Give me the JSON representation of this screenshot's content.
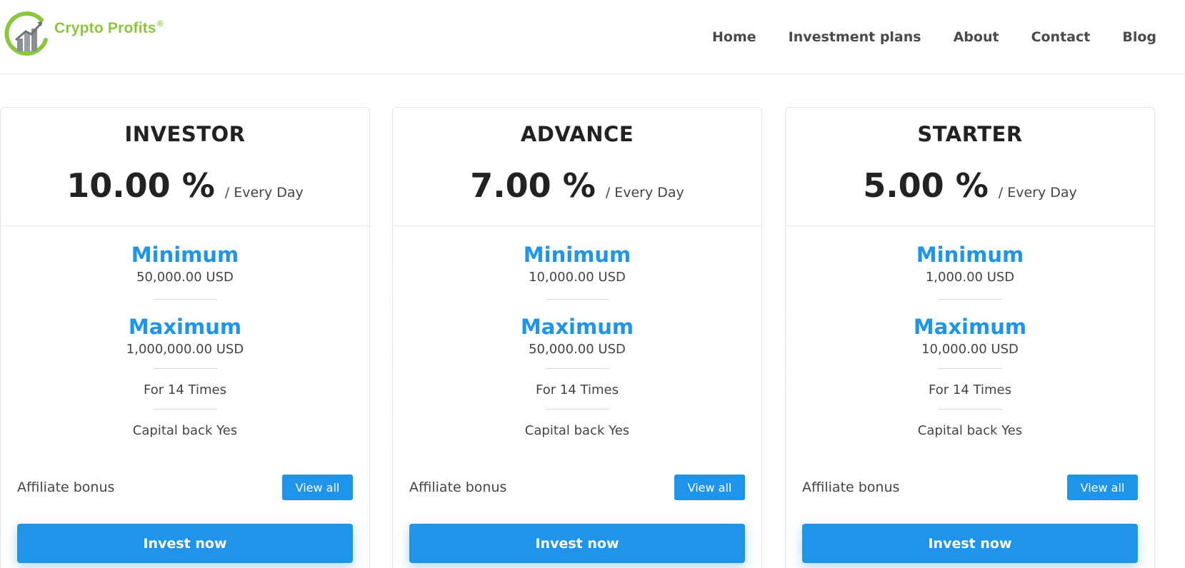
{
  "brand": {
    "name": "Crypto Profits",
    "registered_mark": "®",
    "icon": "bar-chart-circle-logo",
    "color_green": "#8cc63f",
    "color_gray": "#8a8d91"
  },
  "nav": {
    "items": [
      {
        "label": "Home"
      },
      {
        "label": "Investment plans"
      },
      {
        "label": "About"
      },
      {
        "label": "Contact"
      },
      {
        "label": "Blog"
      }
    ]
  },
  "colors": {
    "accent": "#1e95e8",
    "text_dark": "#222222",
    "text_body": "#444444",
    "border": "#e3e6ea"
  },
  "plans": [
    {
      "name": "INVESTOR",
      "rate": "10.00 %",
      "period": "/ Every Day",
      "min_label": "Minimum",
      "min_amount": "50,000.00 USD",
      "max_label": "Maximum",
      "max_amount": "1,000,000.00 USD",
      "duration": "For 14 Times",
      "capital_back": "Capital back Yes",
      "bonus_label": "Affiliate bonus",
      "view_all_label": "View all",
      "invest_label": "Invest now"
    },
    {
      "name": "ADVANCE",
      "rate": "7.00 %",
      "period": "/ Every Day",
      "min_label": "Minimum",
      "min_amount": "10,000.00 USD",
      "max_label": "Maximum",
      "max_amount": "50,000.00 USD",
      "duration": "For 14 Times",
      "capital_back": "Capital back Yes",
      "bonus_label": "Affiliate bonus",
      "view_all_label": "View all",
      "invest_label": "Invest now"
    },
    {
      "name": "STARTER",
      "rate": "5.00 %",
      "period": "/ Every Day",
      "min_label": "Minimum",
      "min_amount": "1,000.00 USD",
      "max_label": "Maximum",
      "max_amount": "10,000.00 USD",
      "duration": "For 14 Times",
      "capital_back": "Capital back Yes",
      "bonus_label": "Affiliate bonus",
      "view_all_label": "View all",
      "invest_label": "Invest now"
    }
  ]
}
